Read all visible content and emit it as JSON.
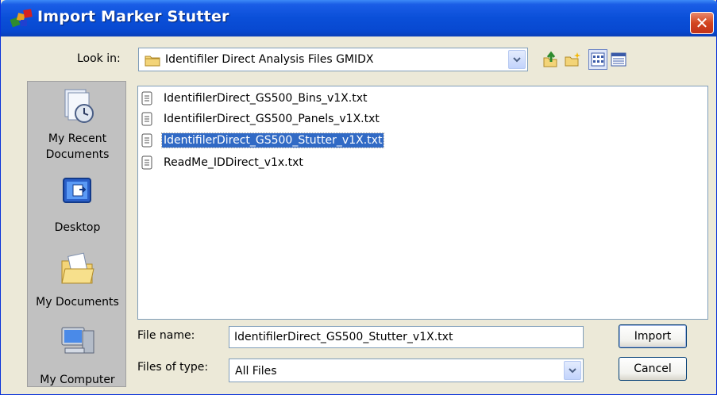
{
  "window": {
    "title": "Import Marker Stutter",
    "close_symbol": "✕",
    "title_icon": "marker-panels-icon"
  },
  "look_in": {
    "label": "Look in:",
    "value": "Identifiler Direct Analysis Files GMIDX",
    "icon": "folder-icon"
  },
  "toolbar": {
    "icons": [
      "back-up-folder-icon",
      "new-folder-icon",
      "view-menu-icon",
      "details-view-icon"
    ]
  },
  "places_bar": {
    "items": [
      {
        "label_line1": "My Recent",
        "label_line2": "Documents",
        "icon": "recent-documents-icon"
      },
      {
        "label_line1": "Desktop",
        "label_line2": "",
        "icon": "desktop-icon"
      },
      {
        "label_line1": "My Documents",
        "label_line2": "",
        "icon": "my-documents-icon"
      },
      {
        "label_line1": "My Computer",
        "label_line2": "",
        "icon": "my-computer-icon"
      }
    ]
  },
  "files": [
    {
      "name": "IdentifilerDirect_GS500_Bins_v1X.txt",
      "selected": false
    },
    {
      "name": "IdentifilerDirect_GS500_Panels_v1X.txt",
      "selected": false
    },
    {
      "name": "IdentifilerDirect_GS500_Stutter_v1X.txt",
      "selected": true
    },
    {
      "name": "ReadMe_IDDirect_v1x.txt",
      "selected": false
    }
  ],
  "file_name": {
    "label": "File name:",
    "value": "IdentifilerDirect_GS500_Stutter_v1X.txt"
  },
  "file_type": {
    "label": "Files of type:",
    "value": "All Files"
  },
  "buttons": {
    "import_label": "Import",
    "cancel_label": "Cancel"
  },
  "colors": {
    "titlebar": "#0a4fd8",
    "selection": "#316ac5",
    "dialog_bg": "#ece9d8"
  }
}
